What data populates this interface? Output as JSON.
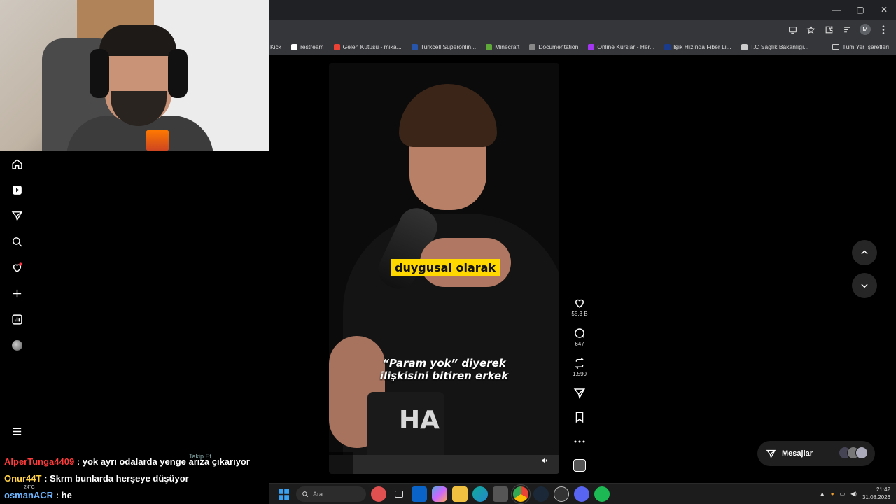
{
  "window": {
    "minimize": "—",
    "maximize": "▢",
    "close": "✕"
  },
  "toolbar": {
    "profile_initial": "M"
  },
  "bookmarks": [
    {
      "label": "Kick",
      "color": "#53fc18"
    },
    {
      "label": "restream",
      "color": "#ffffff"
    },
    {
      "label": "Gelen Kutusu - mika...",
      "color": "#ea4335"
    },
    {
      "label": "Turkcell Superonlin...",
      "color": "#2855ac"
    },
    {
      "label": "Minecraft",
      "color": "#5fa83a"
    },
    {
      "label": "Documentation",
      "color": "#888888"
    },
    {
      "label": "Online Kurslar - Her...",
      "color": "#a435f0"
    },
    {
      "label": "Işık Hızında Fiber Li...",
      "color": "#1a3b8c"
    },
    {
      "label": "T.C Sağlık Bakanlığı...",
      "color": "#cccccc"
    }
  ],
  "bookmarks_all": "Tüm Yer İşaretleri",
  "reel": {
    "caption": "duygusal olarak",
    "subtitle_line1": "“Param yok” diyerek",
    "subtitle_line2": "ilişkisini bitiren erkek",
    "mug_logo": "HA"
  },
  "actions": {
    "likes": "55,3 B",
    "comments": "647",
    "reposts": "1.590"
  },
  "messages": {
    "label": "Mesajlar"
  },
  "chat": {
    "follow_faded": "Takip Et",
    "lines": [
      {
        "user": "AlperTunga4409",
        "text": " : yok ayrı odalarda yenge arıza çıkarıyor",
        "color": "#ff3b3b"
      },
      {
        "user": "Onur44T",
        "text": " : Skrm bunlarda herşeye düşüyor",
        "color": "#ffd24a"
      },
      {
        "user": "osmanACR",
        "text": " : he",
        "color": "#6fb6ff"
      }
    ]
  },
  "taskbar": {
    "search_placeholder": "Ara",
    "weather": "24°C",
    "time": "21:42",
    "date": "31.08.2026"
  }
}
